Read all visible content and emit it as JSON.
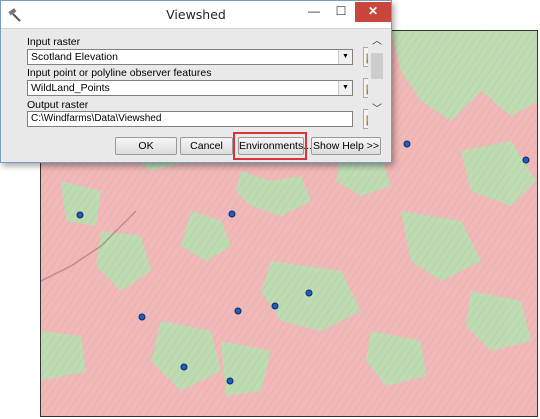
{
  "window": {
    "title": "Viewshed",
    "minimize_glyph": "—",
    "maximize_glyph": "☐",
    "close_glyph": "✕"
  },
  "form": {
    "input_raster_label": "Input raster",
    "input_raster_value": "Scotland Elevation",
    "observer_label": "Input point or polyline observer features",
    "observer_value": "WildLand_Points",
    "output_label": "Output raster",
    "output_value": "C:\\Windfarms\\Data\\Viewshed"
  },
  "buttons": {
    "ok": "OK",
    "cancel": "Cancel",
    "environments": "Environments...",
    "show_help": "Show Help >>"
  },
  "map": {
    "visible_color": "#b9dfb1",
    "not_visible_color": "#f0b8b8",
    "observer_point_color": "#1f5fbf",
    "observer_points": 12
  },
  "colors": {
    "highlight": "#d8343a",
    "close_button": "#c9463d"
  }
}
